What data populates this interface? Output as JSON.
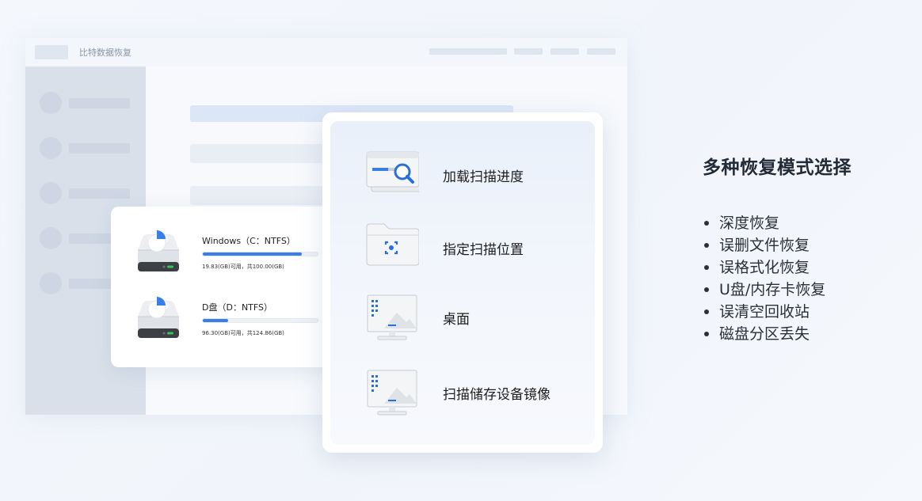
{
  "app": {
    "title": "比特数据恢复"
  },
  "drives": [
    {
      "name": "Windows（C：NTFS）",
      "info": "19.83(GB)可用，共100.00(GB)",
      "used_fraction": 0.86
    },
    {
      "name": "D盘（D：NTFS）",
      "info": "96.30(GB)可用，共124.86(GB)",
      "used_fraction": 0.22
    }
  ],
  "modes": [
    {
      "label": "加载扫描进度",
      "icon": "load-scan-progress-icon"
    },
    {
      "label": "指定扫描位置",
      "icon": "scan-location-folder-icon"
    },
    {
      "label": "桌面",
      "icon": "desktop-monitor-icon"
    },
    {
      "label": "扫描储存设备镜像",
      "icon": "storage-image-monitor-icon"
    }
  ],
  "features": {
    "title": "多种恢复模式选择",
    "items": [
      "深度恢复",
      "误删文件恢复",
      "误格式化恢复",
      "U盘/内存卡恢复",
      "误清空回收站",
      "磁盘分区丢失"
    ]
  },
  "colors": {
    "accent": "#3a7ee8",
    "disk_body": "#e6e8eb",
    "disk_base": "#3b4045",
    "disk_led": "#35c55a"
  }
}
